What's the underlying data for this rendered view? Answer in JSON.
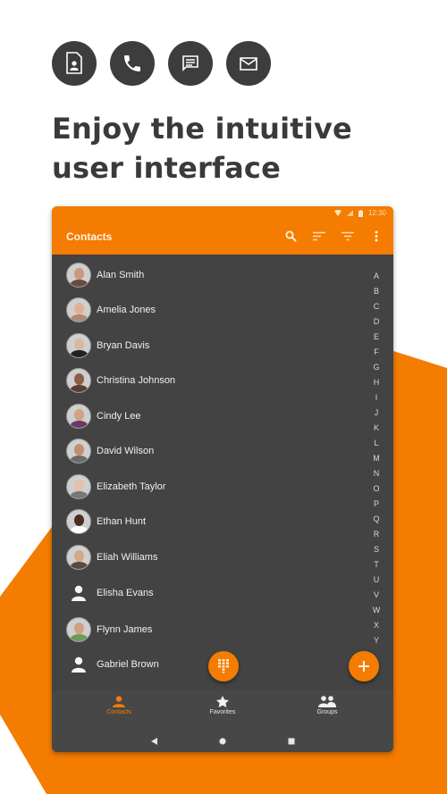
{
  "colors": {
    "accent": "#f47c00",
    "dark": "#434343",
    "headline": "#3a3a3a"
  },
  "feature_icons": [
    {
      "icon": "contact-card-icon"
    },
    {
      "icon": "phone-icon"
    },
    {
      "icon": "message-icon"
    },
    {
      "icon": "mail-icon"
    }
  ],
  "headline": "Enjoy the intuitive user interface",
  "device": {
    "status_bar": {
      "time": "12:30",
      "icons": [
        "wifi-icon",
        "signal-icon",
        "battery-icon"
      ]
    },
    "app_bar": {
      "title": "Contacts",
      "actions": [
        "search-icon",
        "sort-icon",
        "filter-icon",
        "more-vert-icon"
      ]
    },
    "contacts": [
      {
        "name": "Alan Smith",
        "avatar": "photo"
      },
      {
        "name": "Amelia Jones",
        "avatar": "photo"
      },
      {
        "name": "Bryan Davis",
        "avatar": "photo"
      },
      {
        "name": "Christina Johnson",
        "avatar": "photo"
      },
      {
        "name": "Cindy Lee",
        "avatar": "photo"
      },
      {
        "name": "David Wilson",
        "avatar": "photo"
      },
      {
        "name": "Elizabeth Taylor",
        "avatar": "photo"
      },
      {
        "name": "Ethan Hunt",
        "avatar": "photo"
      },
      {
        "name": "Eliah Williams",
        "avatar": "photo"
      },
      {
        "name": "Elisha Evans",
        "avatar": "placeholder"
      },
      {
        "name": "Flynn James",
        "avatar": "photo"
      },
      {
        "name": "Gabriel Brown",
        "avatar": "placeholder"
      }
    ],
    "alphabet_index": [
      "A",
      "B",
      "C",
      "D",
      "E",
      "F",
      "G",
      "H",
      "I",
      "J",
      "K",
      "L",
      "M",
      "N",
      "O",
      "P",
      "Q",
      "R",
      "S",
      "T",
      "U",
      "V",
      "W",
      "X",
      "Y"
    ],
    "fabs": {
      "dialpad": "dialpad-icon",
      "add": "add-icon"
    },
    "bottom_nav": [
      {
        "label": "Contacts",
        "icon": "person-icon",
        "active": true
      },
      {
        "label": "Favorites",
        "icon": "star-icon",
        "active": false
      },
      {
        "label": "Groups",
        "icon": "group-icon",
        "active": false
      }
    ],
    "system_nav": [
      "back-icon",
      "home-icon",
      "recents-icon"
    ]
  }
}
